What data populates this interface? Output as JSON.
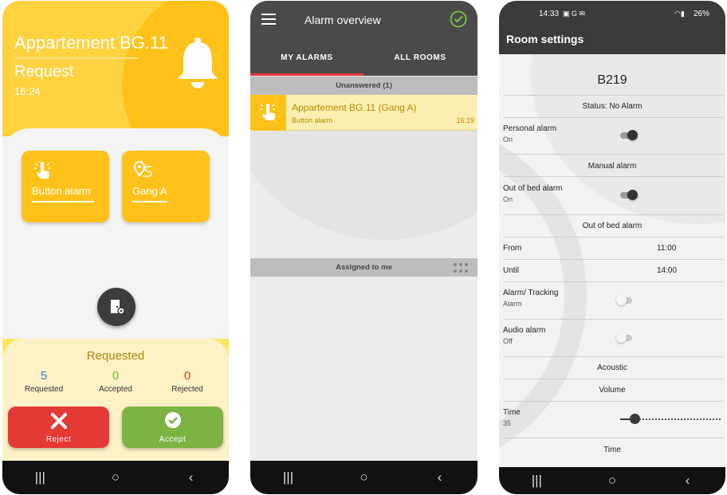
{
  "phone1": {
    "title": "Appartement BG.11",
    "subtitle": "Request",
    "time": "16:24",
    "tiles": [
      {
        "label": "Button alarm",
        "icon": "hand-tap-icon"
      },
      {
        "label": "Gang A",
        "icon": "location-route-icon"
      }
    ],
    "requested_title": "Requested",
    "stats": [
      {
        "value": "5",
        "label": "Requested",
        "color": "#3a7bd5"
      },
      {
        "value": "0",
        "label": "Accepted",
        "color": "#7cb342"
      },
      {
        "value": "0",
        "label": "Rejected",
        "color": "#d84315"
      }
    ],
    "reject_label": "Reject",
    "accept_label": "Accept",
    "colors": {
      "accent": "#ffc21a",
      "reject": "#e53935",
      "accept": "#7cb342"
    }
  },
  "phone2": {
    "title": "Alarm overview",
    "tabs": [
      "MY ALARMS",
      "ALL ROOMS"
    ],
    "active_tab": "MY ALARMS",
    "section_unanswered": "Unanswered (1)",
    "alarm": {
      "title": "Appartement BG.11 (Gang A)",
      "subtitle": "Button alarm",
      "time": "16:19"
    },
    "section_assigned": "Assigned to me"
  },
  "phone3": {
    "status": {
      "time": "14:33",
      "battery": "26%"
    },
    "title": "Room settings",
    "room": "B219",
    "status_text": "Status: No Alarm",
    "personal_alarm": {
      "label": "Personal alarm",
      "value": "On",
      "enabled": true
    },
    "manual_alarm": "Manual alarm",
    "out_of_bed": {
      "label": "Out of bed alarm",
      "value": "On",
      "enabled": true
    },
    "out_of_bed_header": "Out of bed alarm",
    "from": {
      "label": "From",
      "value": "11:00"
    },
    "until": {
      "label": "Until",
      "value": "14:00"
    },
    "tracking": {
      "label": "Alarm/ Tracking",
      "value": "Alarm",
      "enabled": false
    },
    "audio": {
      "label": "Audio alarm",
      "value": "Off",
      "enabled": false
    },
    "acoustic": "Acoustic",
    "volume": "Volume",
    "time_setting": {
      "label": "Time",
      "value": "35",
      "level": 0.14
    },
    "time_footer": "Time"
  },
  "navbar": {
    "recents": "|||",
    "home": "○",
    "back": "‹"
  }
}
